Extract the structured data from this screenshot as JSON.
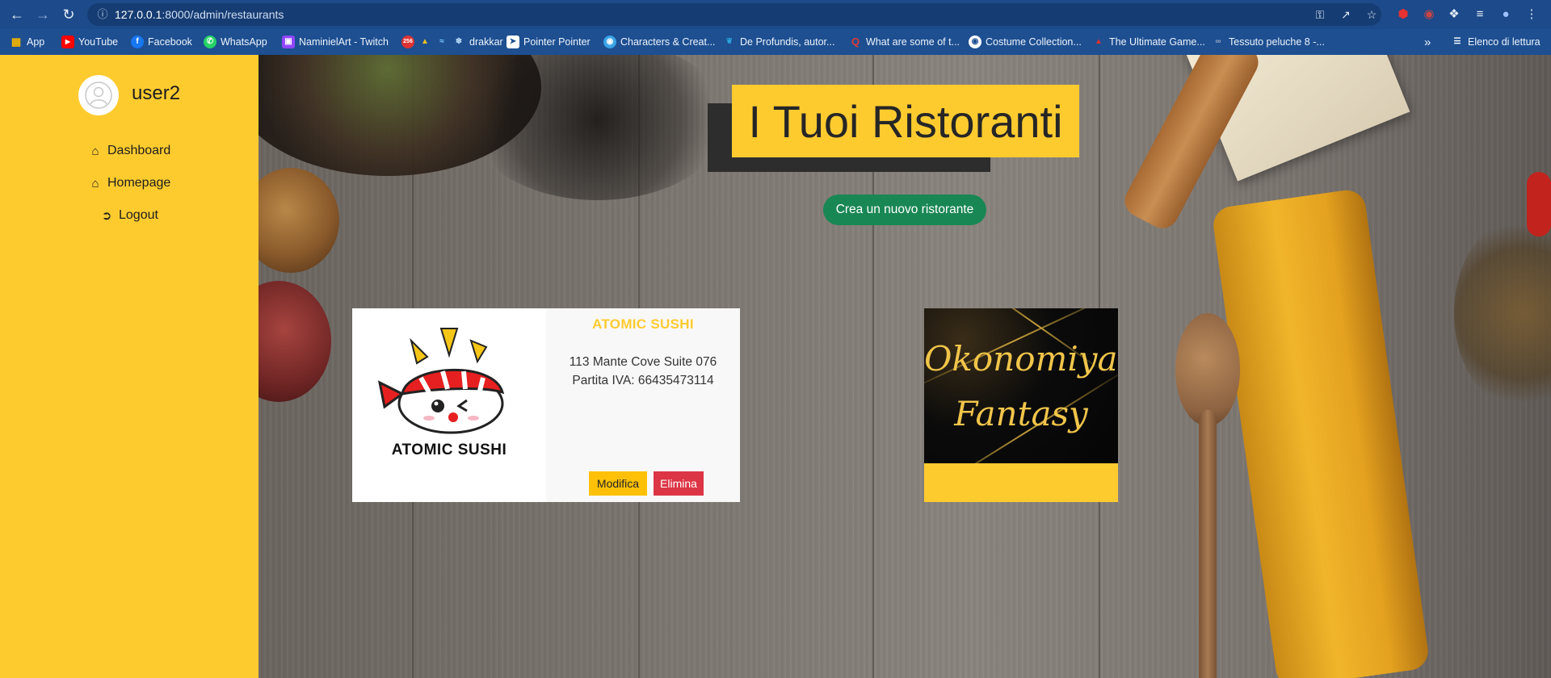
{
  "browser": {
    "url_host": "127.0.0.1",
    "url_rest": ":8000/admin/restaurants",
    "bookmarks": [
      {
        "label": "App",
        "icon": "apps-grid-icon",
        "color": "#f4b400"
      },
      {
        "label": "YouTube",
        "icon": "youtube-icon",
        "color": "#ff0000"
      },
      {
        "label": "Facebook",
        "icon": "facebook-icon",
        "color": "#1877f2"
      },
      {
        "label": "WhatsApp",
        "icon": "whatsapp-icon",
        "color": "#25d366"
      },
      {
        "label": "NaminielArt - Twitch",
        "icon": "twitch-icon",
        "color": "#9146ff"
      },
      {
        "label": "drakkar",
        "icon": "drakkar-icons",
        "color": "#d33"
      },
      {
        "label": "Pointer Pointer",
        "icon": "pointer-icon",
        "color": "#ffffff"
      },
      {
        "label": "Characters & Creat...",
        "icon": "globe-icon",
        "color": "#3ba4e6"
      },
      {
        "label": "De Profundis, autor...",
        "icon": "feather-icon",
        "color": "#2aa6e0"
      },
      {
        "label": "What are some of t...",
        "icon": "quora-icon",
        "color": "#b92b27"
      },
      {
        "label": "Costume Collection...",
        "icon": "globe-icon",
        "color": "#ffffff"
      },
      {
        "label": "The Ultimate Game...",
        "icon": "triangle-icon",
        "color": "#e03030"
      },
      {
        "label": "Tessuto peluche 8 -...",
        "icon": "link-icon",
        "color": "#9aa7c0"
      }
    ],
    "reading_list": "Elenco di lettura"
  },
  "sidebar": {
    "username": "user2",
    "links": [
      {
        "label": "Dashboard",
        "icon": "home-icon"
      },
      {
        "label": "Homepage",
        "icon": "home-icon"
      },
      {
        "label": "Logout",
        "icon": "sign-out-icon"
      }
    ]
  },
  "main": {
    "title": "I Tuoi Ristoranti",
    "create_button": "Crea un nuovo ristorante",
    "restaurants": [
      {
        "name": "ATOMIC SUSHI",
        "address": "113 Mante Cove Suite 076",
        "vat": "Partita IVA: 66435473114",
        "logo_text": "ATOMIC SUSHI",
        "edit_label": "Modifica",
        "delete_label": "Elimina"
      },
      {
        "logo_line1": "Okonomiyaki",
        "logo_line2": "Fantasy"
      }
    ]
  },
  "colors": {
    "accent_yellow": "#fecb2f",
    "create_green": "#198754",
    "delete_red": "#dc3545",
    "edit_yellow": "#fec107"
  }
}
